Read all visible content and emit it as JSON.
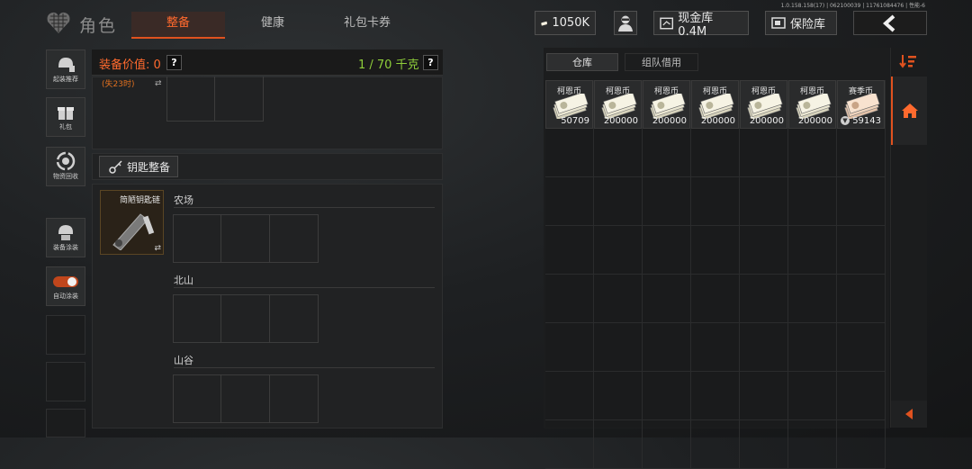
{
  "version": "1.0.158.158(17) | 062100039 | 11761084476 | 性能-6",
  "header": {
    "title": "角色",
    "tabs": [
      {
        "label": "整备",
        "active": true
      },
      {
        "label": "健康",
        "active": false
      },
      {
        "label": "礼包卡券",
        "active": false
      }
    ],
    "currency": "1050K",
    "cash_vault": "现金库 0.4M",
    "safe": "保险库"
  },
  "left_nav": [
    {
      "label": "起装推荐",
      "icon": "helmet-icon"
    },
    {
      "label": "礼包",
      "icon": "gift-icon"
    },
    {
      "label": "物资回收",
      "icon": "recycle-icon"
    },
    {
      "label": "装备涂装",
      "icon": "paint-icon"
    },
    {
      "label": "自动涂装",
      "icon": "toggle-icon"
    }
  ],
  "loadout": {
    "value_label": "装备价值: 0",
    "weight": "1 / 70 千克",
    "help": "?",
    "partial_text": "(失23时)",
    "key_section": "钥匙整备",
    "keychain_name": "简陋钥匙链",
    "areas": [
      "农场",
      "北山",
      "山谷"
    ]
  },
  "warehouse": {
    "tabs": [
      {
        "label": "仓库",
        "active": true
      },
      {
        "label": "组队借用",
        "active": false
      }
    ],
    "items": [
      {
        "name": "柯恩币",
        "qty": "50709"
      },
      {
        "name": "柯恩币",
        "qty": "200000"
      },
      {
        "name": "柯恩币",
        "qty": "200000"
      },
      {
        "name": "柯恩币",
        "qty": "200000"
      },
      {
        "name": "柯恩币",
        "qty": "200000"
      },
      {
        "name": "柯恩币",
        "qty": "200000"
      },
      {
        "name": "赛季币",
        "qty": "59143"
      }
    ]
  },
  "colors": {
    "accent": "#e0521f",
    "weight_green": "#8fcf3a"
  }
}
